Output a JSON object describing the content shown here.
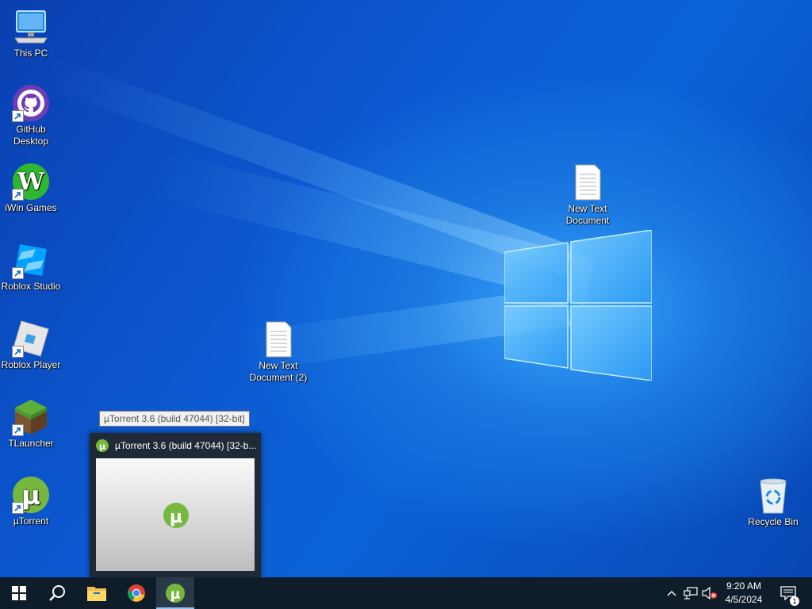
{
  "desktop": {
    "icons": [
      {
        "label": "This PC",
        "icon": "computer-icon"
      },
      {
        "label": "GitHub Desktop",
        "icon": "github-icon"
      },
      {
        "label": "iWin Games",
        "icon": "iwin-icon"
      },
      {
        "label": "Roblox Studio",
        "icon": "roblox-studio-icon"
      },
      {
        "label": "Roblox Player",
        "icon": "roblox-player-icon"
      },
      {
        "label": "TLauncher",
        "icon": "minecraft-icon"
      },
      {
        "label": "µTorrent",
        "icon": "utorrent-icon"
      },
      {
        "label": "New Text Document (2)",
        "icon": "text-file-icon"
      },
      {
        "label": "New Text Document",
        "icon": "text-file-icon"
      },
      {
        "label": "Recycle Bin",
        "icon": "recycle-bin-icon"
      }
    ]
  },
  "tooltip": {
    "text": "µTorrent 3.6  (build 47044) [32-bit]"
  },
  "preview": {
    "title": "µTorrent 3.6  (build 47044) [32-b..."
  },
  "taskbar": {
    "buttons": [
      "start-icon",
      "search-icon",
      "file-explorer-icon",
      "chrome-icon",
      "utorrent-icon"
    ],
    "clock": {
      "time": "9:20 AM",
      "date": "4/5/2024"
    },
    "notification_count": "1"
  },
  "colors": {
    "taskbar": "#0f1d2b",
    "accent": "#8cc4f5",
    "desktop": "#0b62d6"
  }
}
